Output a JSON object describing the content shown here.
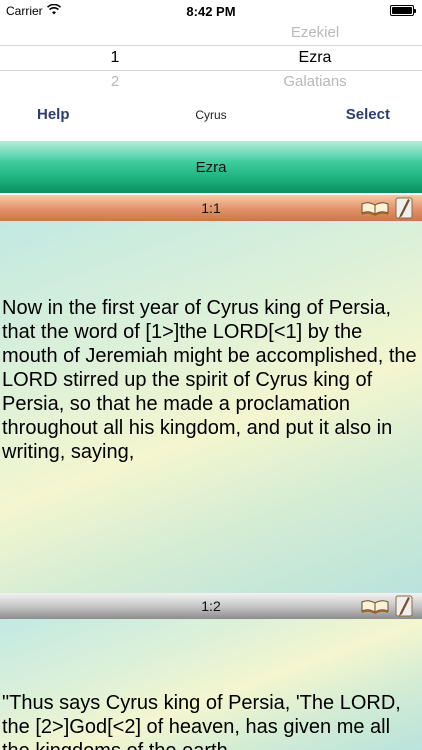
{
  "status": {
    "carrier": "Carrier",
    "time": "8:42 PM",
    "icons": [
      "wifi-icon",
      "battery-icon"
    ],
    "battery_level": 1.0
  },
  "picker": {
    "rows": [
      {
        "num": "",
        "book": "Ezekiel"
      },
      {
        "num": "1",
        "book": "Ezra"
      },
      {
        "num": "2",
        "book": "Galatians"
      }
    ]
  },
  "toolbar": {
    "help_label": "Help",
    "center_text": "Cyrus",
    "select_label": "Select"
  },
  "book": {
    "title": "Ezra"
  },
  "verses": [
    {
      "ref": "1:1",
      "text": "Now in the first year of Cyrus king of Persia, that the word of [1>]the LORD[<1] by the mouth of Jeremiah might be accomplished, the LORD stirred up the spirit of Cyrus king of Persia, so that he made a proclamation throughout all his kingdom, and put it also in writing, saying,"
    },
    {
      "ref": "1:2",
      "text": "\"Thus says Cyrus king of Persia, 'The LORD, the [2>]God[<2] of heaven, has given me all the kingdoms of the earth"
    }
  ],
  "colors": {
    "accent_text": "#2c3e70",
    "header_green": "#1aae7a",
    "verse_bar_orange": "#e2916a",
    "verse_bar_gray": "#c8c8c8"
  }
}
